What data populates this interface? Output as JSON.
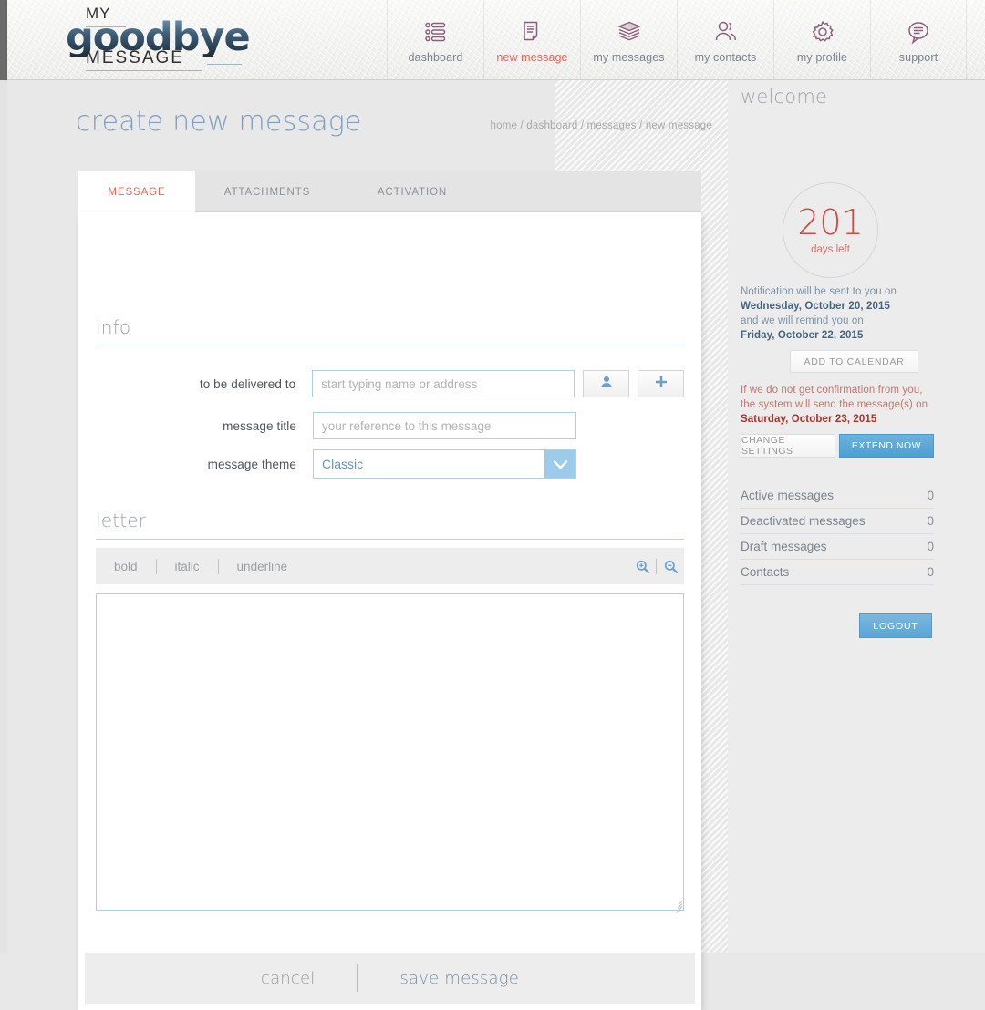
{
  "brand": {
    "line1": "MY",
    "line2": "goodbye",
    "line3": "MESSAGE"
  },
  "nav": {
    "items": [
      {
        "label": "dashboard",
        "icon": "list-icon",
        "active": false
      },
      {
        "label": "new message",
        "icon": "document-icon",
        "active": true
      },
      {
        "label": "my messages",
        "icon": "stack-icon",
        "active": false
      },
      {
        "label": "my contacts",
        "icon": "people-icon",
        "active": false
      },
      {
        "label": "my profile",
        "icon": "gear-icon",
        "active": false
      },
      {
        "label": "support",
        "icon": "chat-icon",
        "active": false
      }
    ]
  },
  "page": {
    "title": "create new message",
    "breadcrumb": "home / dashboard / messages / new message"
  },
  "tabs": [
    {
      "label": "MESSAGE",
      "active": true
    },
    {
      "label": "ATTACHMENTS",
      "active": false
    },
    {
      "label": "ACTIVATION",
      "active": false
    }
  ],
  "form": {
    "info_heading": "info",
    "deliver_to": {
      "label": "to be delivered to",
      "value": "",
      "placeholder": "start typing name or address"
    },
    "message_title": {
      "label": "message title",
      "value": "",
      "placeholder": "your reference to this message"
    },
    "message_theme": {
      "label": "message theme",
      "value": "Classic"
    },
    "contact_button_icon": "person-icon",
    "add_button_icon": "plus-icon"
  },
  "letter": {
    "heading": "letter",
    "toolbar": {
      "bold": "bold",
      "italic": "italic",
      "underline": "underline",
      "zoom_in_icon": "zoom-in-icon",
      "zoom_out_icon": "zoom-out-icon"
    },
    "body": "",
    "placeholder": ""
  },
  "actions": {
    "cancel": "cancel",
    "save": "save message"
  },
  "sidebar": {
    "title": "welcome",
    "days": {
      "number": "201",
      "label": "days left"
    },
    "notification": {
      "line1": "Notification will be sent to you on",
      "date1": "Wednesday, October 20, 2015",
      "line2": "and we will remind you on",
      "date2": "Friday, October 22, 2015"
    },
    "calendar_button": "ADD TO CALENDAR",
    "warning": {
      "line1": "If we do not get confirmation from you,",
      "line2": "the system will send the message(s) on",
      "date": "Saturday, October 23, 2015"
    },
    "change_settings_button": "CHANGE SETTINGS",
    "extend_now_button": "EXTEND NOW",
    "stats": [
      {
        "label": "Active messages",
        "value": "0"
      },
      {
        "label": "Deactivated messages",
        "value": "0"
      },
      {
        "label": "Draft messages",
        "value": "0"
      },
      {
        "label": "Contacts",
        "value": "0"
      }
    ],
    "logout_button": "LOGOUT"
  },
  "colors": {
    "accent_red": "#e2695c",
    "accent_blue": "#7d9fc4",
    "nav_icon_purple": "#8b5f7d",
    "days_red": "#ce4a46",
    "button_blue": "#5aa6d5"
  }
}
